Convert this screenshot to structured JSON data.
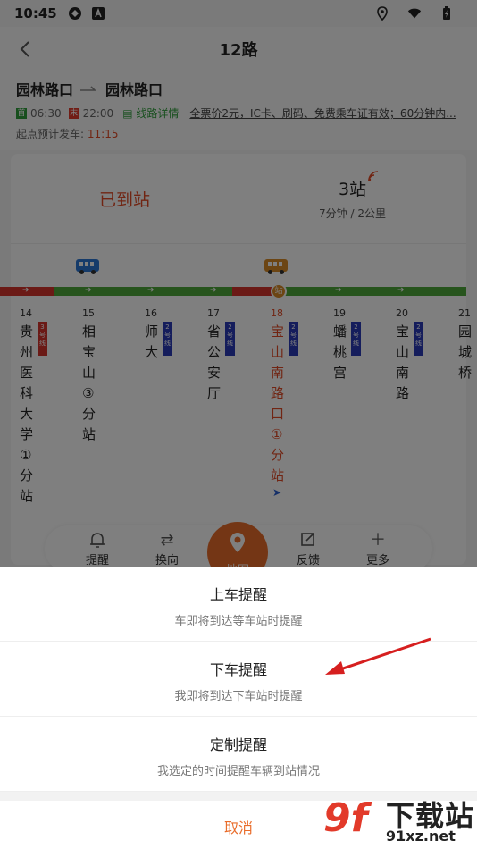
{
  "status": {
    "time": "10:45"
  },
  "nav": {
    "title": "12路"
  },
  "route": {
    "from": "园林路口",
    "to": "园林路口",
    "start_tag": "首",
    "start_time": "06:30",
    "end_tag": "末",
    "end_time": "22:00",
    "detail_link": "线路详情",
    "price": "全票价2元，IC卡、刷码、免费乘车证有效；60分钟内...",
    "depart_label": "起点预计发车:",
    "depart_time": "11:15"
  },
  "arrival": {
    "status": "已到站",
    "stops": "3站",
    "sub": "7分钟 / 2公里"
  },
  "stations": [
    {
      "no": "14",
      "name": "贵州医科大学①分站",
      "badge": "3号线",
      "badge_color": "#d6342c"
    },
    {
      "no": "15",
      "name": "相宝山③分站",
      "badge": "",
      "badge_color": ""
    },
    {
      "no": "16",
      "name": "师大",
      "badge": "2号线",
      "badge_color": "#2a3ab8"
    },
    {
      "no": "17",
      "name": "省公安厅",
      "badge": "2号线",
      "badge_color": "#2a3ab8"
    },
    {
      "no": "18",
      "name": "宝山南路口①分站",
      "badge": "2号线",
      "badge_color": "#2a3ab8",
      "current": true
    },
    {
      "no": "19",
      "name": "蟠桃宫",
      "badge": "2号线",
      "badge_color": "#2a3ab8"
    },
    {
      "no": "20",
      "name": "宝山南路",
      "badge": "2号线",
      "badge_color": "#2a3ab8"
    },
    {
      "no": "21",
      "name": "园城桥",
      "badge": "",
      "badge_color": ""
    }
  ],
  "dock": {
    "remind": "提醒",
    "switch": "换向",
    "map": "地图",
    "feedback": "反馈",
    "more": "更多"
  },
  "sheet": {
    "opt1_title": "上车提醒",
    "opt1_desc": "车即将到达等车站时提醒",
    "opt2_title": "下车提醒",
    "opt2_desc": "我即将到达下车站时提醒",
    "opt3_title": "定制提醒",
    "opt3_desc": "我选定的时间提醒车辆到站情况",
    "cancel": "取消"
  },
  "watermark": {
    "mark": "9f",
    "brand": "下载站",
    "url": "91xz.net"
  },
  "colors": {
    "accent": "#e96c2a",
    "arrived": "#e24b26",
    "line_green": "#4ea93b",
    "line_red": "#d6342c"
  }
}
